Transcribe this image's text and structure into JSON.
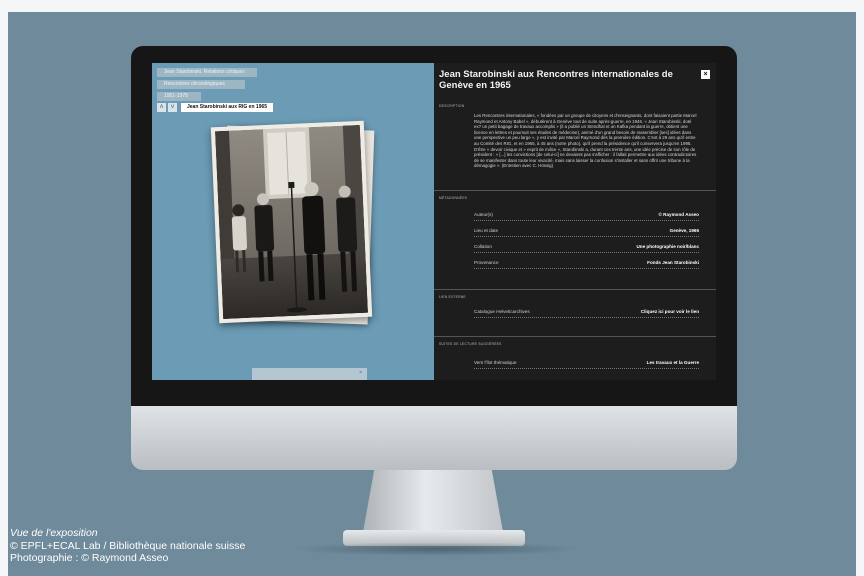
{
  "viewer": {
    "breadcrumbs": [
      "Jean Starobinski, Relations critiques",
      "Rencontres chronologiques",
      "1951-1978"
    ],
    "current": "Jean Starobinski aux RIG en 1965",
    "nav": {
      "up": "˄",
      "down": "˅"
    },
    "thumb_close": "×"
  },
  "panel": {
    "title": "Jean Starobinski aux Rencontres internationales de Genève en 1965",
    "close": "×",
    "description_label": "DESCRIPTION",
    "description": "Les Rencontres internationales, « fondées par un groupe de citoyens et d'enseignants, dont faisaient partie Marcel Raymond et Antony Babel », débutèrent à Genève tout de suite après-guerre, en 1946. « Jean Starobinski, doté ex? un petit bagage de travaux accomplis » (il a publié un Stendhal et un Kafka pendant la guerre, obtient une licence en lettres et poursuit ses études de médecine), animé d'un grand besoin de rassembler [ses] idées dans une perspective un peu large », y est invité par Marcel Raymond dès la première édition. C'est à 29 ans qu'il entre au Comité des RIG, et en 1965, à 45 ans (notre photo), qu'il prend la présidence qu'il conservera jusqu'en 1995. D'être « devoir civique et » esprit de milice », Starobinski a, durant ces trente ans, une idée précise de son rôle de président : « [...] les convictions [de celui-ci] ne devaient pas s'afficher : il fallait permettre aux idées contradictoires de se manifester dans toute leur vivacité, mais sans laisser la confusion s'installer et sans offrir une tribune à la démagogie ». (Entretien avec C. Hössig)",
    "metadata_label": "MÉTADONNÉES",
    "metadata": [
      {
        "key": "Auteur(s)",
        "value": "© Raymond Asseo"
      },
      {
        "key": "Lieu et date",
        "value": "Genève, 1965"
      },
      {
        "key": "Collation",
        "value": "Une photographie noir/blanc"
      },
      {
        "key": "Provenance",
        "value": "Fonds Jean Starobinski"
      }
    ],
    "links_label": "LIEN EXTERNE",
    "link": {
      "key": "Catalogue Helveticarchives",
      "value": "Cliquez ici pour voir le lien"
    },
    "reading_label": "SUITES DE LECTURE SUGGÉRÉES",
    "reading": {
      "key": "Vers l'îlot thématique",
      "value": "Les travaux et la Guerre"
    }
  },
  "caption": {
    "line1": "Vue de l'exposition",
    "line2": "© EPFL+ECAL Lab / Bibliothèque nationale suisse",
    "line3": "Photographie : © Raymond Asseo"
  }
}
